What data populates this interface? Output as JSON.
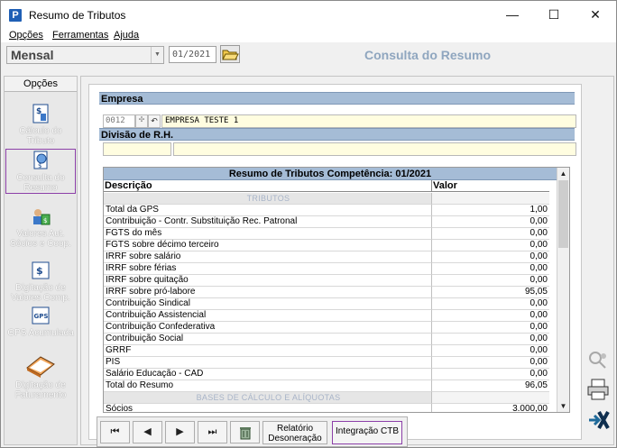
{
  "window": {
    "title": "Resumo de Tributos",
    "app_icon": "P",
    "minimize": "—",
    "maximize": "☐",
    "close": "✕"
  },
  "menu": [
    "Opções",
    "Ferramentas",
    "Ajuda"
  ],
  "toolbar": {
    "period": "Mensal",
    "date": "01/2021",
    "screen_title": "Consulta do Resumo"
  },
  "sidebar": {
    "header": "Opções",
    "items": [
      {
        "label": "Cálculo do Tributo",
        "icon": "calculator-icon"
      },
      {
        "label": "Consulta do Resumo",
        "icon": "report-icon",
        "selected": true
      },
      {
        "label": "Valores Aut. Sócios e Coop.",
        "icon": "people-money-icon"
      },
      {
        "label": "Digitação de Valores Comp.",
        "icon": "entry-icon"
      },
      {
        "label": "GPS Acumulada",
        "icon": "gps-icon"
      },
      {
        "label": "Digitação de Faturamento",
        "icon": "book-icon"
      }
    ]
  },
  "form": {
    "empresa_label": "Empresa",
    "empresa_code": "0012",
    "empresa_name": "EMPRESA TESTE 1",
    "divisao_label": "Divisão de R.H."
  },
  "grid": {
    "title": "Resumo de Tributos Competência: 01/2021",
    "col_descricao": "Descrição",
    "col_valor": "Valor",
    "rows": [
      {
        "d": "TRIBUTOS",
        "v": "",
        "group": true
      },
      {
        "d": "Total da GPS",
        "v": "1,00"
      },
      {
        "d": "Contribuição - Contr. Substituição Rec. Patronal",
        "v": "0,00"
      },
      {
        "d": "FGTS do mês",
        "v": "0,00"
      },
      {
        "d": "FGTS sobre décimo terceiro",
        "v": "0,00"
      },
      {
        "d": "IRRF sobre salário",
        "v": "0,00"
      },
      {
        "d": "IRRF sobre férias",
        "v": "0,00"
      },
      {
        "d": "IRRF sobre quitação",
        "v": "0,00"
      },
      {
        "d": "IRRF sobre pró-labore",
        "v": "95,05"
      },
      {
        "d": "Contribuição Sindical",
        "v": "0,00"
      },
      {
        "d": "Contribuição Assistencial",
        "v": "0,00"
      },
      {
        "d": "Contribuição Confederativa",
        "v": "0,00"
      },
      {
        "d": "Contribuição Social",
        "v": "0,00"
      },
      {
        "d": "GRRF",
        "v": "0,00"
      },
      {
        "d": "PIS",
        "v": "0,00"
      },
      {
        "d": "Salário Educação - CAD",
        "v": "0,00"
      },
      {
        "d": "Total do Resumo",
        "v": "96,05"
      },
      {
        "d": "BASES DE CÁLCULO E ALÍQUOTAS",
        "v": "",
        "group": true
      },
      {
        "d": "Sócios",
        "v": "3.000,00"
      }
    ]
  },
  "nav": {
    "first": "⏮",
    "prev": "◀",
    "next": "▶",
    "last": "⏭",
    "relatorio": "Relatório",
    "desoneracao": "Desoneração",
    "integracao": "Integração CTB"
  }
}
